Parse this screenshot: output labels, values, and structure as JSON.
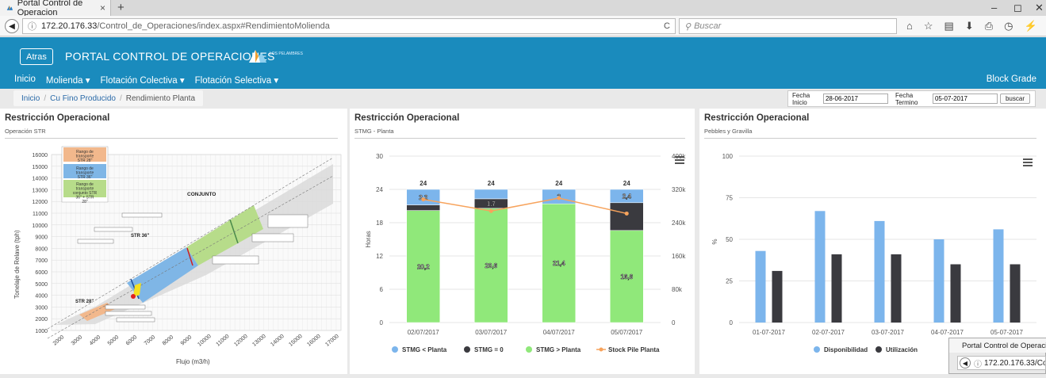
{
  "browser": {
    "tab_title": "Portal Control de Operacion",
    "tab_close": "×",
    "new_tab": "+",
    "url_info_icon": "info-icon",
    "url_host": "172.20.176.33",
    "url_path": "/Control_de_Operaciones/index.aspx#RendimientoMolienda",
    "reload": "C",
    "search_placeholder": "Buscar",
    "window_controls": [
      "–",
      "◻",
      "✕"
    ]
  },
  "portal": {
    "back_label": "Atras",
    "title": "PORTAL CONTROL DE OPERACIONES",
    "logo_text": "LOS PELAMBRES",
    "menu": [
      {
        "label": "Inicio",
        "dropdown": false
      },
      {
        "label": "Molienda",
        "dropdown": true
      },
      {
        "label": "Flotación Colectiva",
        "dropdown": true
      },
      {
        "label": "Flotación Selectiva",
        "dropdown": true
      }
    ],
    "right_menu": "Block Grade",
    "accent": "#1a8bbd"
  },
  "breadcrumb": {
    "items": [
      "Inicio",
      "Cu Fino Producido",
      "Rendimiento Planta"
    ]
  },
  "date_filter": {
    "start_label": "Fecha Inicio",
    "start_value": "28-06-2017",
    "end_label": "Fecha Termino",
    "end_value": "05-07-2017",
    "button": "buscar"
  },
  "panels": [
    {
      "title": "Restricción Operacional",
      "subtitle": "Operación STR",
      "diagram": {
        "ylabel": "Tonelaje de Relave (tph)",
        "xlabel": "Flujo (m3/h)",
        "yticks": [
          "16000",
          "15000",
          "14000",
          "13000",
          "12000",
          "11000",
          "10000",
          "9000",
          "8000",
          "7000",
          "6000",
          "5000",
          "4000",
          "3000",
          "2000",
          "1000"
        ],
        "xticks": [
          "2000",
          "3000",
          "4000",
          "5000",
          "6000",
          "7000",
          "8000",
          "9000",
          "10000",
          "11000",
          "12000",
          "13000",
          "14000",
          "15000",
          "16000",
          "17000"
        ],
        "legend": [
          {
            "text": "Rango de transporte STR 28\"",
            "color": "#f2b88c"
          },
          {
            "text": "Rango de transporte STR 36\"",
            "color": "#7fb6e6"
          },
          {
            "text": "Rango de transporte conjunto STR 36\" + STR 28\"",
            "color": "#b7dc8a"
          }
        ],
        "labels": [
          "CONJUNTO",
          "STR 36\"",
          "STR 28\""
        ]
      }
    },
    {
      "title": "Restricción Operacional",
      "subtitle": "STMG - Planta"
    },
    {
      "title": "Restricción Operacional",
      "subtitle": "Pebbles y Gravilla"
    }
  ],
  "chart_data": [
    {
      "type": "bar",
      "stacked": true,
      "categories": [
        "02/07/2017",
        "03/07/2017",
        "04/07/2017",
        "05/07/2017"
      ],
      "ylabel": "Horas",
      "ylim": [
        0,
        30
      ],
      "yticks": [
        0,
        6,
        12,
        18,
        24,
        30
      ],
      "y2lim": [
        0,
        400000
      ],
      "y2ticks": [
        "0",
        "80k",
        "160k",
        "240k",
        "320k",
        "400k"
      ],
      "totals": [
        "24",
        "24",
        "24",
        "24"
      ],
      "series": [
        {
          "name": "STMG > Planta",
          "color": "#90e87a",
          "values": [
            20.2,
            20.6,
            21.4,
            16.6
          ],
          "labels": [
            "20,2",
            "20,6",
            "21,4",
            "16,6"
          ]
        },
        {
          "name": "STMG = 0",
          "color": "#3a3a3f",
          "values": [
            1,
            1.7,
            0,
            5
          ],
          "labels": [
            "",
            "1,7",
            "",
            ""
          ]
        },
        {
          "name": "STMG < Planta",
          "color": "#7cb5ec",
          "values": [
            2.8,
            1.7,
            2.6,
            2.4
          ],
          "labels": [
            "2,2",
            "",
            "2",
            "2,4"
          ]
        },
        {
          "name": "Stock Pile Planta",
          "type": "line",
          "axis": "y2",
          "color": "#f7a35c",
          "values": [
            296000,
            268000,
            299000,
            262000
          ]
        }
      ],
      "legend": [
        "STMG < Planta",
        "STMG = 0",
        "STMG > Planta",
        "Stock Pile Planta"
      ],
      "legend_position": "bottom"
    },
    {
      "type": "bar",
      "categories": [
        "01-07-2017",
        "02-07-2017",
        "03-07-2017",
        "04-07-2017",
        "05-07-2017"
      ],
      "ylabel": "%",
      "ylim": [
        0,
        100
      ],
      "yticks": [
        0,
        25,
        50,
        75,
        100
      ],
      "series": [
        {
          "name": "Disponibilidad",
          "color": "#7cb5ec",
          "values": [
            43,
            67,
            61,
            50,
            56
          ]
        },
        {
          "name": "Utilización",
          "color": "#3a3a3f",
          "values": [
            31,
            41,
            41,
            35,
            35
          ]
        }
      ],
      "legend_position": "bottom"
    }
  ],
  "second_window": {
    "tab_title": "Portal Control de Operacio",
    "url": "172.20.176.33/Co"
  }
}
